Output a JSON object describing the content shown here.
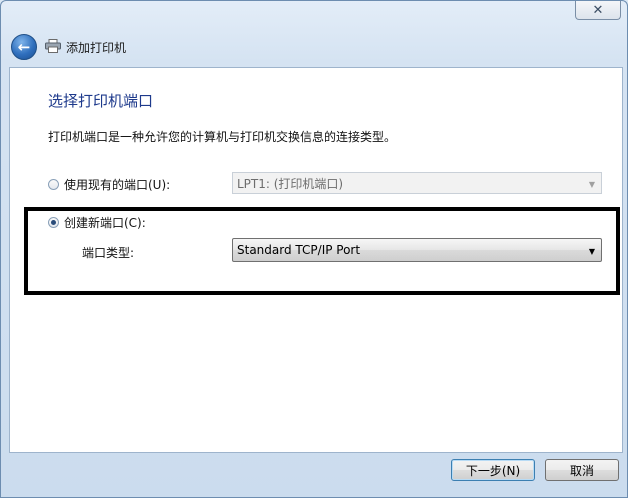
{
  "window": {
    "close_glyph": "✕",
    "back_glyph": "🡐",
    "title": "添加打印机"
  },
  "page": {
    "heading": "选择打印机端口",
    "description": "打印机端口是一种允许您的计算机与打印机交换信息的连接类型。"
  },
  "options": {
    "existing_port": {
      "label": "使用现有的端口(U):",
      "selected": false,
      "value": "LPT1: (打印机端口)",
      "enabled": false
    },
    "new_port": {
      "label": "创建新端口(C):",
      "selected": true,
      "type_label": "端口类型:",
      "type_value": "Standard TCP/IP Port"
    },
    "dropdown_glyph": "▼"
  },
  "buttons": {
    "next": "下一步(N)",
    "cancel": "取消"
  },
  "colors": {
    "heading": "#1e3a8c",
    "highlight_box": "#000000",
    "window_frame": "#cbdcee"
  }
}
